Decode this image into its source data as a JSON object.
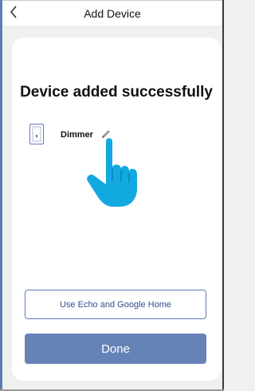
{
  "header": {
    "back_icon": "chevron-left-icon",
    "title": "Add Device"
  },
  "card": {
    "headline": "Device added successfully",
    "device": {
      "icon": "light-switch-icon",
      "name": "Dimmer",
      "edit_icon": "pencil-icon"
    },
    "secondary_button": "Use Echo and Google Home",
    "primary_button": "Done"
  },
  "colors": {
    "page_background": "#f0f0f0",
    "card_background": "#ffffff",
    "primary_button": "#6683b8",
    "outline_button_border": "#5f7bb4",
    "hand_cursor": "#12a9e0"
  }
}
